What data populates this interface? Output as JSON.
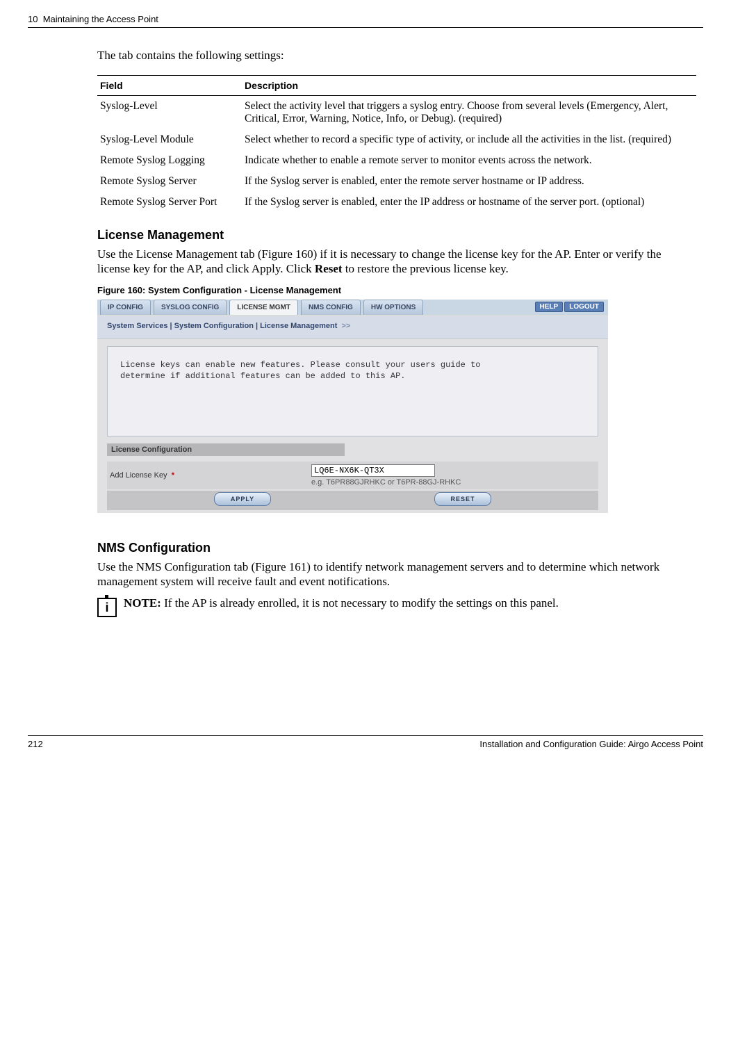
{
  "header": {
    "chapter": "10",
    "title": "Maintaining the Access Point"
  },
  "intro": "The tab contains the following settings:",
  "table": {
    "head_field": "Field",
    "head_desc": "Description",
    "rows": [
      {
        "field": "Syslog-Level",
        "desc": "Select the activity level that triggers a syslog entry. Choose from several levels (Emergency, Alert, Critical, Error, Warning, Notice, Info, or Debug). (required)"
      },
      {
        "field": "Syslog-Level Module",
        "desc": "Select whether to record a specific type of activity, or include all the activities in the list. (required)"
      },
      {
        "field": "Remote Syslog Logging",
        "desc": "Indicate whether to enable a remote server to monitor events across the network."
      },
      {
        "field": "Remote Syslog Server",
        "desc": "If the Syslog server is enabled, enter the remote server hostname or IP address."
      },
      {
        "field": "Remote Syslog Server Port",
        "desc": "If the Syslog server is enabled, enter the IP address or hostname of the server port. (optional)"
      }
    ]
  },
  "license": {
    "heading": "License Management",
    "para": "Use the License Management tab (Figure 160) if it is necessary to change the license key for the AP. Enter or verify the license key for the AP, and click Apply. Click ",
    "para_bold": "Reset",
    "para_tail": " to restore the previous license key.",
    "figcap": "Figure 160:    System Configuration - License Management"
  },
  "ui": {
    "tabs": [
      "IP CONFIG",
      "SYSLOG CONFIG",
      "LICENSE MGMT",
      "NMS CONFIG",
      "HW OPTIONS"
    ],
    "help": "HELP",
    "logout": "LOGOUT",
    "breadcrumb": "System Services | System Configuration | License Management",
    "bc_arrows": ">>",
    "infobox_l1": "License  keys  can  enable  new  features.  Please  consult  your  users  guide  to",
    "infobox_l2": "determine if additional features can be added to this AP.",
    "section_title": "License Configuration",
    "form_label": "Add License Key",
    "req_mark": "*",
    "input_value": "LQ6E-NX6K-QT3X",
    "hint": "e.g. T6PR88GJRHKC or T6PR-88GJ-RHKC",
    "apply": "APPLY",
    "reset": "RESET"
  },
  "nms": {
    "heading": "NMS Configuration",
    "para": "Use the NMS Configuration tab (Figure 161) to identify network management servers and to determine which network management system will receive fault and event notifications."
  },
  "note": {
    "icon_char": "i",
    "bold": "NOTE:",
    "text": " If the AP is already enrolled, it is not necessary to modify the settings on this panel."
  },
  "footer": {
    "page": "212",
    "title": "Installation and Configuration Guide: Airgo Access Point"
  }
}
